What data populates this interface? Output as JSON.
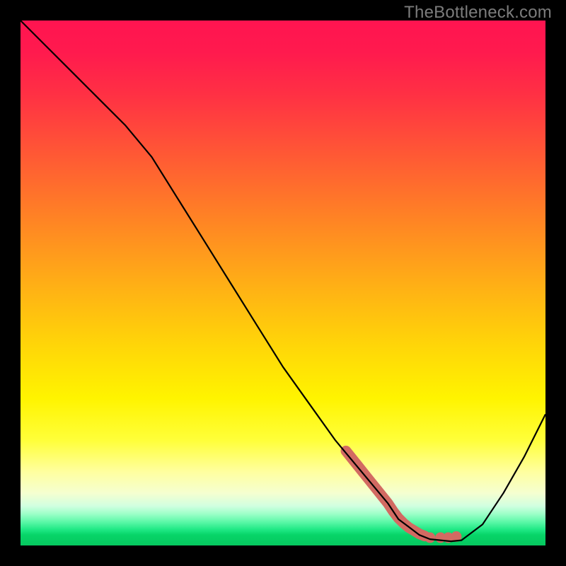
{
  "watermark": "TheBottleneck.com",
  "chart_data": {
    "type": "line",
    "title": "",
    "xlabel": "",
    "ylabel": "",
    "xlim": [
      0,
      100
    ],
    "ylim": [
      0,
      100
    ],
    "grid": false,
    "legend": false,
    "series": [
      {
        "name": "bottleneck-curve",
        "color": "#000000",
        "x": [
          0,
          5,
          10,
          15,
          20,
          25,
          30,
          35,
          40,
          45,
          50,
          55,
          60,
          65,
          70,
          72,
          74,
          76,
          78,
          80,
          82,
          84,
          88,
          92,
          96,
          100
        ],
        "values": [
          100,
          95,
          90,
          85,
          80,
          74,
          66,
          58,
          50,
          42,
          34,
          27,
          20,
          14,
          8,
          5,
          3.5,
          2,
          1.2,
          1,
          0.8,
          1,
          4,
          10,
          17,
          25
        ]
      },
      {
        "name": "highlight-dots",
        "color": "#d26a62",
        "x": [
          62,
          64,
          66,
          68,
          70,
          71,
          72,
          73,
          74,
          75,
          76,
          77,
          78,
          80,
          81.5,
          83
        ],
        "values": [
          18,
          15.5,
          13,
          10.5,
          8,
          6.5,
          5.2,
          4.2,
          3.4,
          2.8,
          2.2,
          1.8,
          1.5,
          1.5,
          1.5,
          1.7
        ]
      }
    ],
    "gradient_stops": [
      {
        "pos": 0,
        "color": "#ff1450"
      },
      {
        "pos": 50,
        "color": "#ffae16"
      },
      {
        "pos": 80,
        "color": "#ffff3a"
      },
      {
        "pos": 97,
        "color": "#1ee884"
      },
      {
        "pos": 100,
        "color": "#06c85f"
      }
    ]
  }
}
